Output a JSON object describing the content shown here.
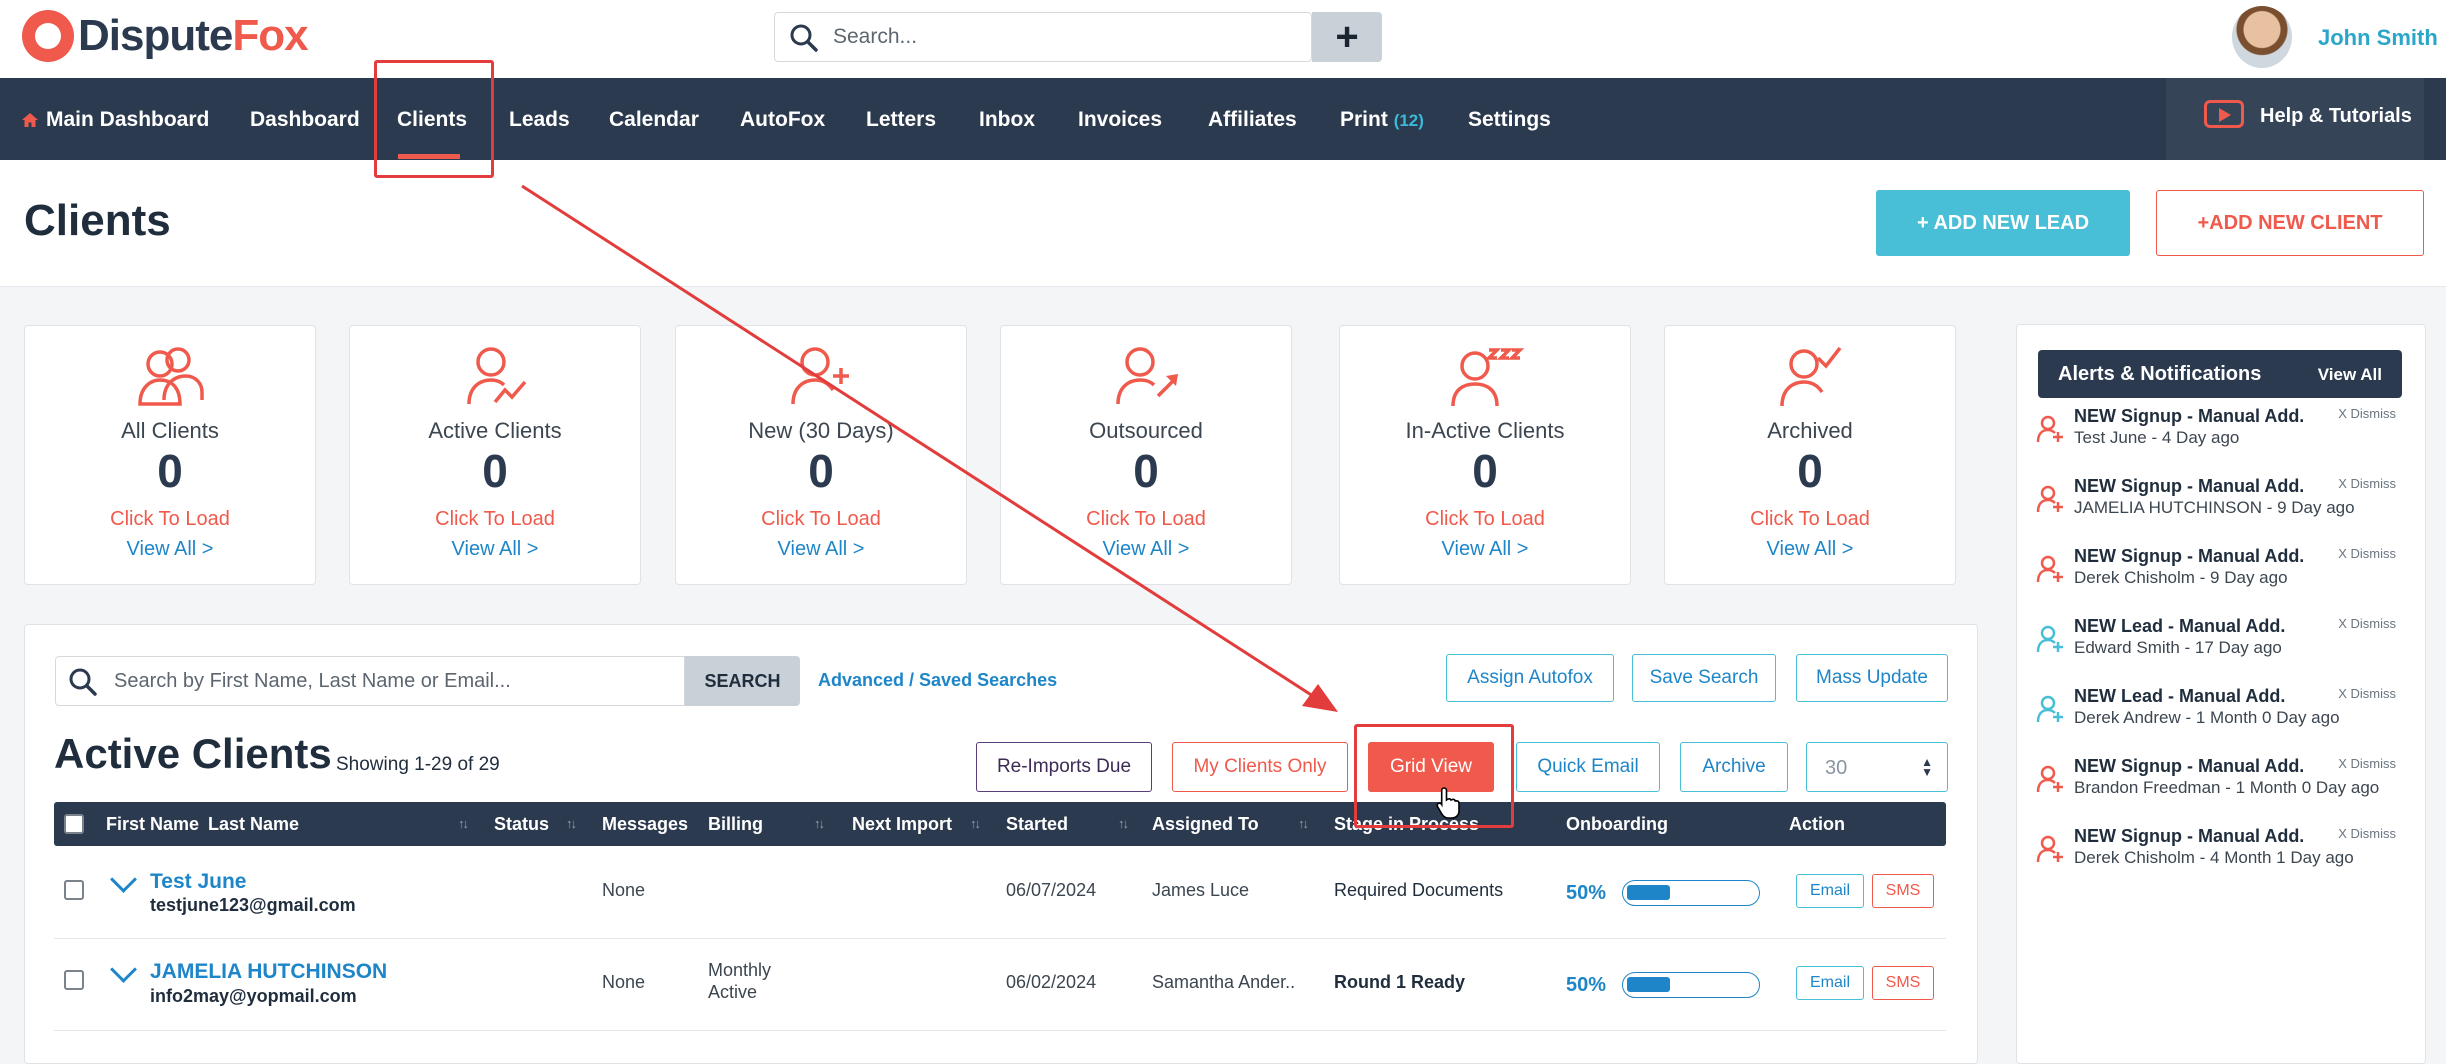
{
  "brand": {
    "logo_a": "Dispute",
    "logo_b": "Fox"
  },
  "top_search": {
    "placeholder": "Search..."
  },
  "user": {
    "name": "John Smith"
  },
  "nav": {
    "main_dashboard": "Main Dashboard",
    "dashboard": "Dashboard",
    "clients": "Clients",
    "leads": "Leads",
    "calendar": "Calendar",
    "autofox": "AutoFox",
    "letters": "Letters",
    "inbox": "Inbox",
    "invoices": "Invoices",
    "affiliates": "Affiliates",
    "print": "Print",
    "print_count": "(12)",
    "settings": "Settings",
    "help": "Help & Tutorials"
  },
  "page": {
    "title": "Clients",
    "add_lead": "+ ADD NEW LEAD",
    "add_client": "+ADD NEW CLIENT"
  },
  "cards": [
    {
      "title": "All Clients",
      "count": "0",
      "load": "Click To Load",
      "view": "View All >",
      "icon": "users-icon"
    },
    {
      "title": "Active Clients",
      "count": "0",
      "load": "Click To Load",
      "view": "View All >",
      "icon": "user-chart-icon"
    },
    {
      "title": "New (30 Days)",
      "count": "0",
      "load": "Click To Load",
      "view": "View All >",
      "icon": "user-plus-icon"
    },
    {
      "title": "Outsourced",
      "count": "0",
      "load": "Click To Load",
      "view": "View All >",
      "icon": "user-arrow-icon"
    },
    {
      "title": "In-Active Clients",
      "count": "0",
      "load": "Click To Load",
      "view": "View All >",
      "icon": "user-sleep-icon"
    },
    {
      "title": "Archived",
      "count": "0",
      "load": "Click To Load",
      "view": "View All >",
      "icon": "user-check-icon"
    }
  ],
  "client_search": {
    "placeholder": "Search by First Name, Last Name or Email...",
    "button": "SEARCH",
    "advanced": "Advanced / Saved Searches"
  },
  "tools": {
    "assign_autofox": "Assign Autofox",
    "save_search": "Save Search",
    "mass_update": "Mass Update"
  },
  "list": {
    "title": "Active Clients",
    "showing": "Showing 1-29 of 29",
    "reimports": "Re-Imports Due",
    "my_clients": "My Clients Only",
    "grid_view": "Grid View",
    "quick_email": "Quick Email",
    "archive": "Archive",
    "per_page": "30"
  },
  "columns": {
    "first_name": "First Name",
    "last_name": "Last Name",
    "status": "Status",
    "messages": "Messages",
    "billing": "Billing",
    "next_import": "Next Import",
    "started": "Started",
    "assigned_to": "Assigned To",
    "stage": "Stage in Process",
    "onboarding": "Onboarding",
    "action": "Action"
  },
  "rows": [
    {
      "name": "Test June",
      "email": "testjune123@gmail.com",
      "messages": "None",
      "billing_1": "",
      "billing_2": "",
      "started": "06/07/2024",
      "assigned": "James Luce",
      "stage": "Required Documents",
      "onboarding": "50%",
      "onboarding_fraction": 0.5,
      "email_btn": "Email",
      "sms_btn": "SMS"
    },
    {
      "name": "JAMELIA HUTCHINSON",
      "email": "info2may@yopmail.com",
      "messages": "None",
      "billing_1": "Monthly",
      "billing_2": "Active",
      "started": "06/02/2024",
      "assigned": "Samantha Ander..",
      "stage": "Round 1 Ready",
      "onboarding": "50%",
      "onboarding_fraction": 0.5,
      "email_btn": "Email",
      "sms_btn": "SMS"
    }
  ],
  "alerts": {
    "title": "Alerts & Notifications",
    "view_all": "View All",
    "items": [
      {
        "title": "NEW Signup - Manual Add.",
        "sub": "Test June - 4 Day ago",
        "dismiss": "X Dismiss",
        "color": "#ef5a4c"
      },
      {
        "title": "NEW Signup - Manual Add.",
        "sub": "JAMELIA HUTCHINSON - 9 Day ago",
        "dismiss": "X Dismiss",
        "color": "#ef5a4c"
      },
      {
        "title": "NEW Signup - Manual Add.",
        "sub": "Derek Chisholm - 9 Day ago",
        "dismiss": "X Dismiss",
        "color": "#ef5a4c"
      },
      {
        "title": "NEW Lead - Manual Add.",
        "sub": "Edward Smith - 17 Day ago",
        "dismiss": "X Dismiss",
        "color": "#48bfd6"
      },
      {
        "title": "NEW Lead - Manual Add.",
        "sub": "Derek Andrew - 1 Month 0 Day ago",
        "dismiss": "X Dismiss",
        "color": "#48bfd6"
      },
      {
        "title": "NEW Signup - Manual Add.",
        "sub": "Brandon Freedman - 1 Month 0 Day ago",
        "dismiss": "X Dismiss",
        "color": "#ef5a4c"
      },
      {
        "title": "NEW Signup - Manual Add.",
        "sub": "Derek Chisholm - 4 Month 1 Day ago",
        "dismiss": "X Dismiss",
        "color": "#ef5a4c"
      }
    ]
  },
  "colors": {
    "accent": "#ef5a4c",
    "navy": "#2b3a4e",
    "teal": "#48bfd6",
    "link": "#1e86c8"
  }
}
